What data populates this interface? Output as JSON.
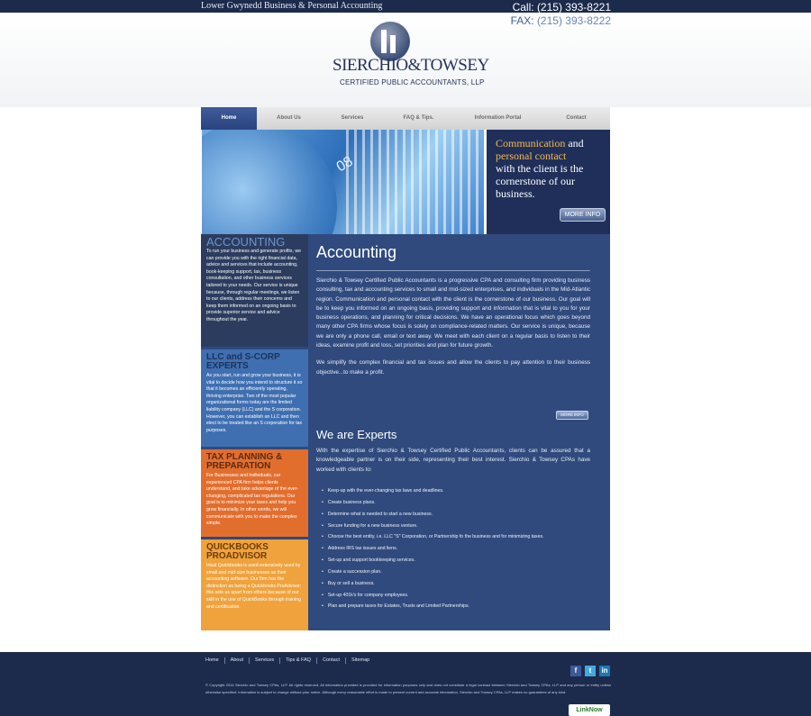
{
  "topbar": {
    "tagline": "Lower Gwynedd Business & Personal Accounting",
    "call_label": "Call:",
    "call_number": "(215) 393-8221",
    "fax_label": "FAX:",
    "fax_number": "(215) 393-8222"
  },
  "logo": {
    "name": "SIERCHIO&TOWSEY",
    "sub": "CERTIFIED PUBLIC ACCOUNTANTS, LLP"
  },
  "nav": [
    {
      "label": "Home",
      "active": true
    },
    {
      "label": "About Us"
    },
    {
      "label": "Services"
    },
    {
      "label": "FAQ & Tips."
    },
    {
      "label": "Information Portal"
    },
    {
      "label": "Contact"
    }
  ],
  "banner": {
    "art_number": "08",
    "line1_hl": "Communication",
    "line1_rest": " and",
    "line2_hl": "personal contact",
    "line3": "with the client is the cornerstone of our business.",
    "button": "MORE INFO"
  },
  "sidebar": {
    "accounting": {
      "title": "ACCOUNTING",
      "text": "To run your business and generate profits, we can provide you with the right financial data, advice and services that include accounting, book-keeping support, tax, business consultation, and other business services tailored to your needs. Our service is unique because, through regular meetings, we listen to our clients, address their concerns and keep them informed on an ongoing basis to provide superior service and advice throughout the year."
    },
    "llc": {
      "title": "LLC and S-CORP EXPERTS",
      "text": "As you start, run and grow your business, it is vital to decide how you intend to structure it so that it becomes an efficiently operating, thriving enterprise. Two of the most popular organizational forms today are the limited liability company (LLC) and the S corporation. However, you can establish an LLC and then elect to be treated like an S corporation for tax purposes."
    },
    "tax": {
      "title": "TAX PLANNING & PREPARATION",
      "text": "For Businesses and Individuals, our experienced CPA firm helps clients understand, and take advantage of the ever-changing, complicated tax regulations. Our goal is to minimize your taxes and help you grow financially. In other words, we will communicate with you to make the complex simple."
    },
    "qb": {
      "title": "QUICKBOOKS PROADVISOR",
      "text": "Intuit Quickbooks is used extensively used by small and mid-size businesses as their accounting software. Our firm has the distinction as being a Quickbooks ProAdvisor; this sets us apart from others because of our skill in the use of QuickBooks through training and certification."
    }
  },
  "content": {
    "heading": "Accounting",
    "para1": "Sierchio & Towsey Certified Public Accountants is a progressive CPA and consulting firm providing business consulting, tax and accounting services to small and mid-sized enterprises, and individuals in the Mid-Atlantic region. Communication and personal contact with the client is the cornerstone of our business. Our goal will be to keep you informed on an ongoing basis, providing support and information that is vital to you for your business operations, and planning for critical decisions. We have an operational focus which goes beyond many other CPA firms whose focus is solely on compliance-related matters. Our service is unique, because we are only a phone call, email or text away. We meet with each client on a regular basis to listen to their ideas, examine profit and loss, set priorities and plan for future growth.",
    "para2": "We simplify the complex financial and tax issues and allow the clients to pay attention to their business objective...to make a profit.",
    "more_button": "MORE INFO",
    "heading2": "We are Experts",
    "para3": "With the expertise of Sierchio & Towsey Certified Public Accountants, clients can be assured that a knowledgeable partner is on their side, representing their best interest. Sierchio & Towsey CPAs have worked with clients to:",
    "bullets": [
      "Keep-up with the ever-changing tax laws and deadlines.",
      "Create business plans.",
      "Determine what is needed to start a new business.",
      "Secure funding for a new business venture.",
      "Choose the best entity, i.e. LLC \"S\" Corporation, or Partnership fo the business and for minimizing taxes.",
      "Address IRS tax issues and liens.",
      "Set-up and support bookkeeping services.",
      "Create a succession plan.",
      "Buy or sell a business.",
      "Set-up 401k's for company employees.",
      "Plan and prepare taxes for Estates, Trusts and Limited Partnerships."
    ]
  },
  "footer": {
    "links": [
      "Home",
      "About",
      "Services",
      "Tips & FAQ",
      "Contact",
      "Sitemap"
    ],
    "social": [
      "f",
      "t",
      "in"
    ],
    "copyright": "© Copyright 2014 Sierchio and Towsey CPAs, LLP. All rights reserved. All information provided is provided for information purposes only and does not constitute a legal contract between Sierchio and Towsey CPAs, LLP and any person or entity unless otherwise specified. Information is subject to change without prior notice. Although every reasonable effort is made to present current and accurate information, Sierchio and Towsey CPAs, LLP makes no guarantees of any kind.",
    "badge": "LinkNow"
  }
}
